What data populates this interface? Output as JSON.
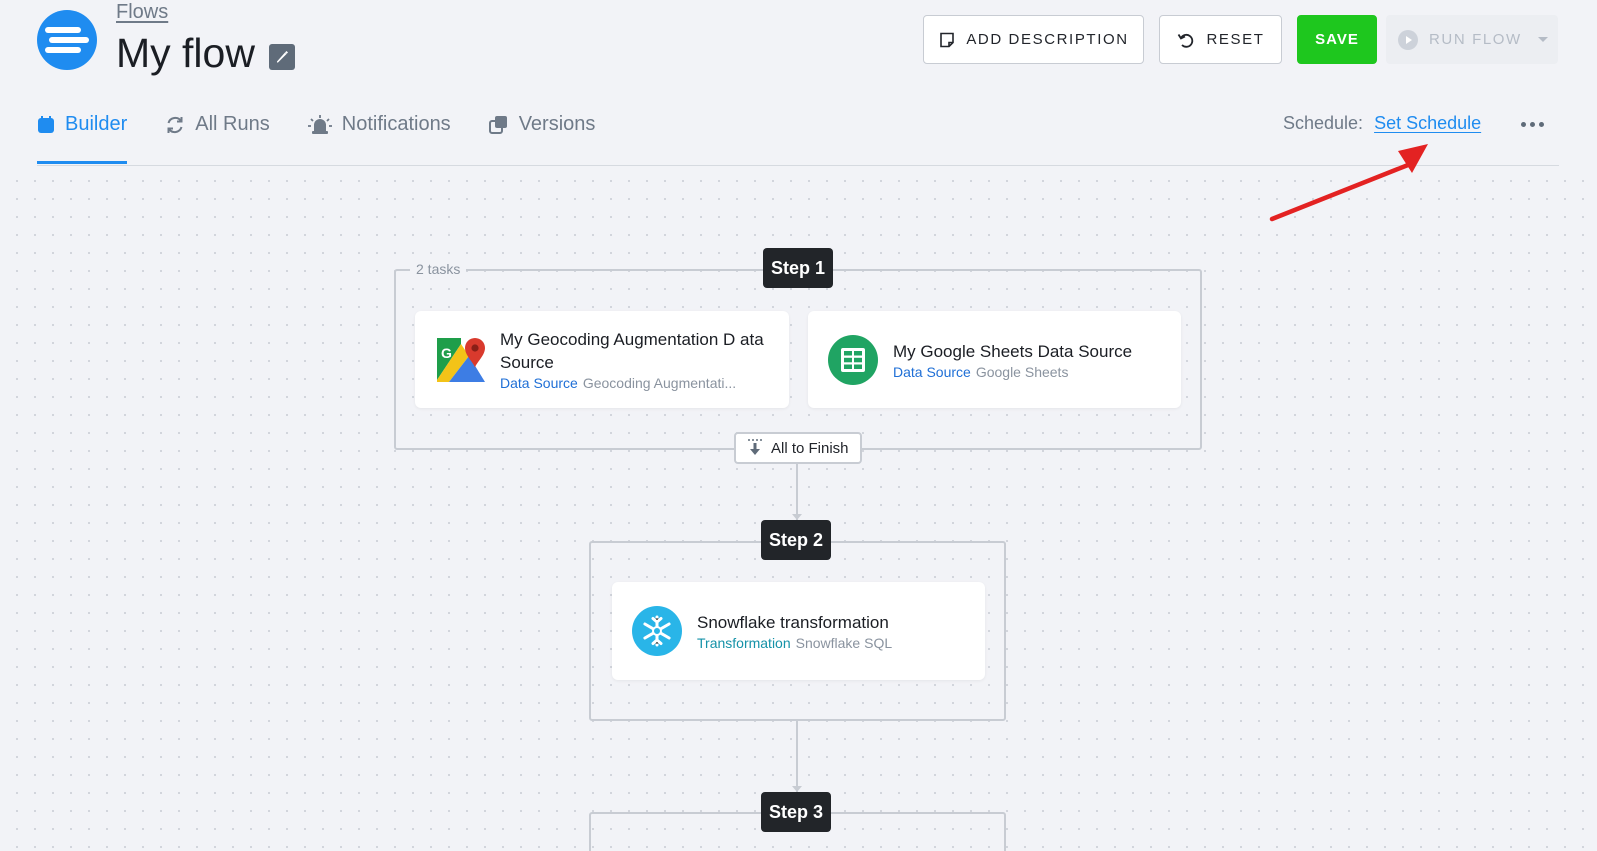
{
  "header": {
    "breadcrumb": "Flows",
    "title": "My flow"
  },
  "toolbar": {
    "add_description": "ADD DESCRIPTION",
    "reset": "RESET",
    "save": "SAVE",
    "run_flow": "RUN FLOW"
  },
  "tabs": [
    {
      "label": "Builder",
      "active": true
    },
    {
      "label": "All Runs",
      "active": false
    },
    {
      "label": "Notifications",
      "active": false
    },
    {
      "label": "Versions",
      "active": false
    }
  ],
  "schedule": {
    "label": "Schedule:",
    "link": "Set Schedule"
  },
  "flow": {
    "steps": [
      {
        "badge": "Step 1",
        "tasks_label": "2 tasks",
        "tasks": [
          {
            "title": "My Geocoding Augmentation D ata Source",
            "type": "Data Source",
            "component": "Geocoding Augmentati...",
            "icon": "google-maps-icon"
          },
          {
            "title": "My Google Sheets Data Source",
            "type": "Data Source",
            "component": "Google Sheets",
            "icon": "google-sheets-icon"
          }
        ],
        "condition": "All to Finish"
      },
      {
        "badge": "Step 2",
        "tasks": [
          {
            "title": "Snowflake transformation",
            "type": "Transformation",
            "component": "Snowflake SQL",
            "icon": "snowflake-icon"
          }
        ]
      },
      {
        "badge": "Step 3",
        "tasks": []
      }
    ]
  },
  "colors": {
    "accent": "#1f8cf0",
    "save": "#1ec71e",
    "step_badge": "#222529",
    "annotation_arrow": "#e32222"
  }
}
